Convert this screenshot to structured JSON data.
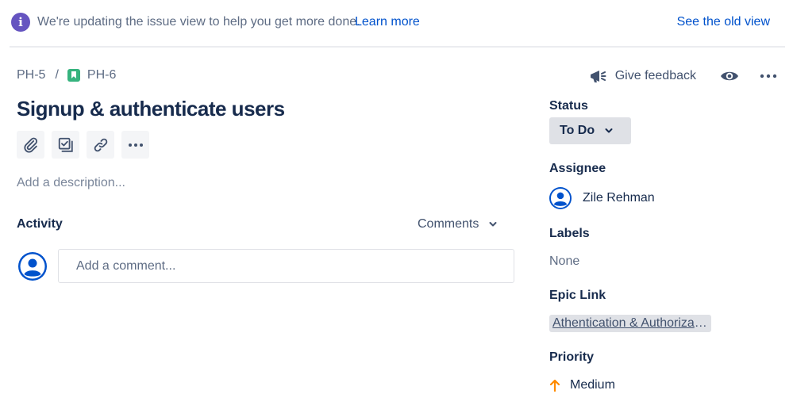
{
  "banner": {
    "info_icon": "info-icon",
    "info_glyph": "i",
    "message": "We're updating the issue view to help you get more done.",
    "learn_more": "Learn more",
    "old_view": "See the old view"
  },
  "breadcrumb": {
    "parent": "PH-5",
    "separator": "/",
    "issue_icon": "story-icon",
    "issue": "PH-6"
  },
  "top_actions": {
    "feedback_label": "Give feedback",
    "feedback_icon": "megaphone-icon",
    "watch_icon": "eye-icon",
    "more_icon": "more-horizontal-icon"
  },
  "issue": {
    "title": "Signup & authenticate users",
    "tools": [
      "paperclip-icon",
      "subtask-icon",
      "link-icon",
      "more-horizontal-icon"
    ],
    "description_placeholder": "Add a description..."
  },
  "activity": {
    "label": "Activity",
    "filter": "Comments",
    "comment_placeholder": "Add a comment..."
  },
  "sidebar": {
    "status_label": "Status",
    "status_value": "To Do",
    "assignee_label": "Assignee",
    "assignee_name": "Zile Rehman",
    "labels_label": "Labels",
    "labels_value": "None",
    "epic_label": "Epic Link",
    "epic_value": "Athentication & Authorization",
    "priority_label": "Priority",
    "priority_value": "Medium"
  },
  "colors": {
    "brand_blue": "#0052cc",
    "banner_purple": "#6554c0",
    "story_green": "#36b37e",
    "priority_orange": "#ff8b00",
    "text": "#172b4d",
    "subtle": "#5e6c84"
  }
}
